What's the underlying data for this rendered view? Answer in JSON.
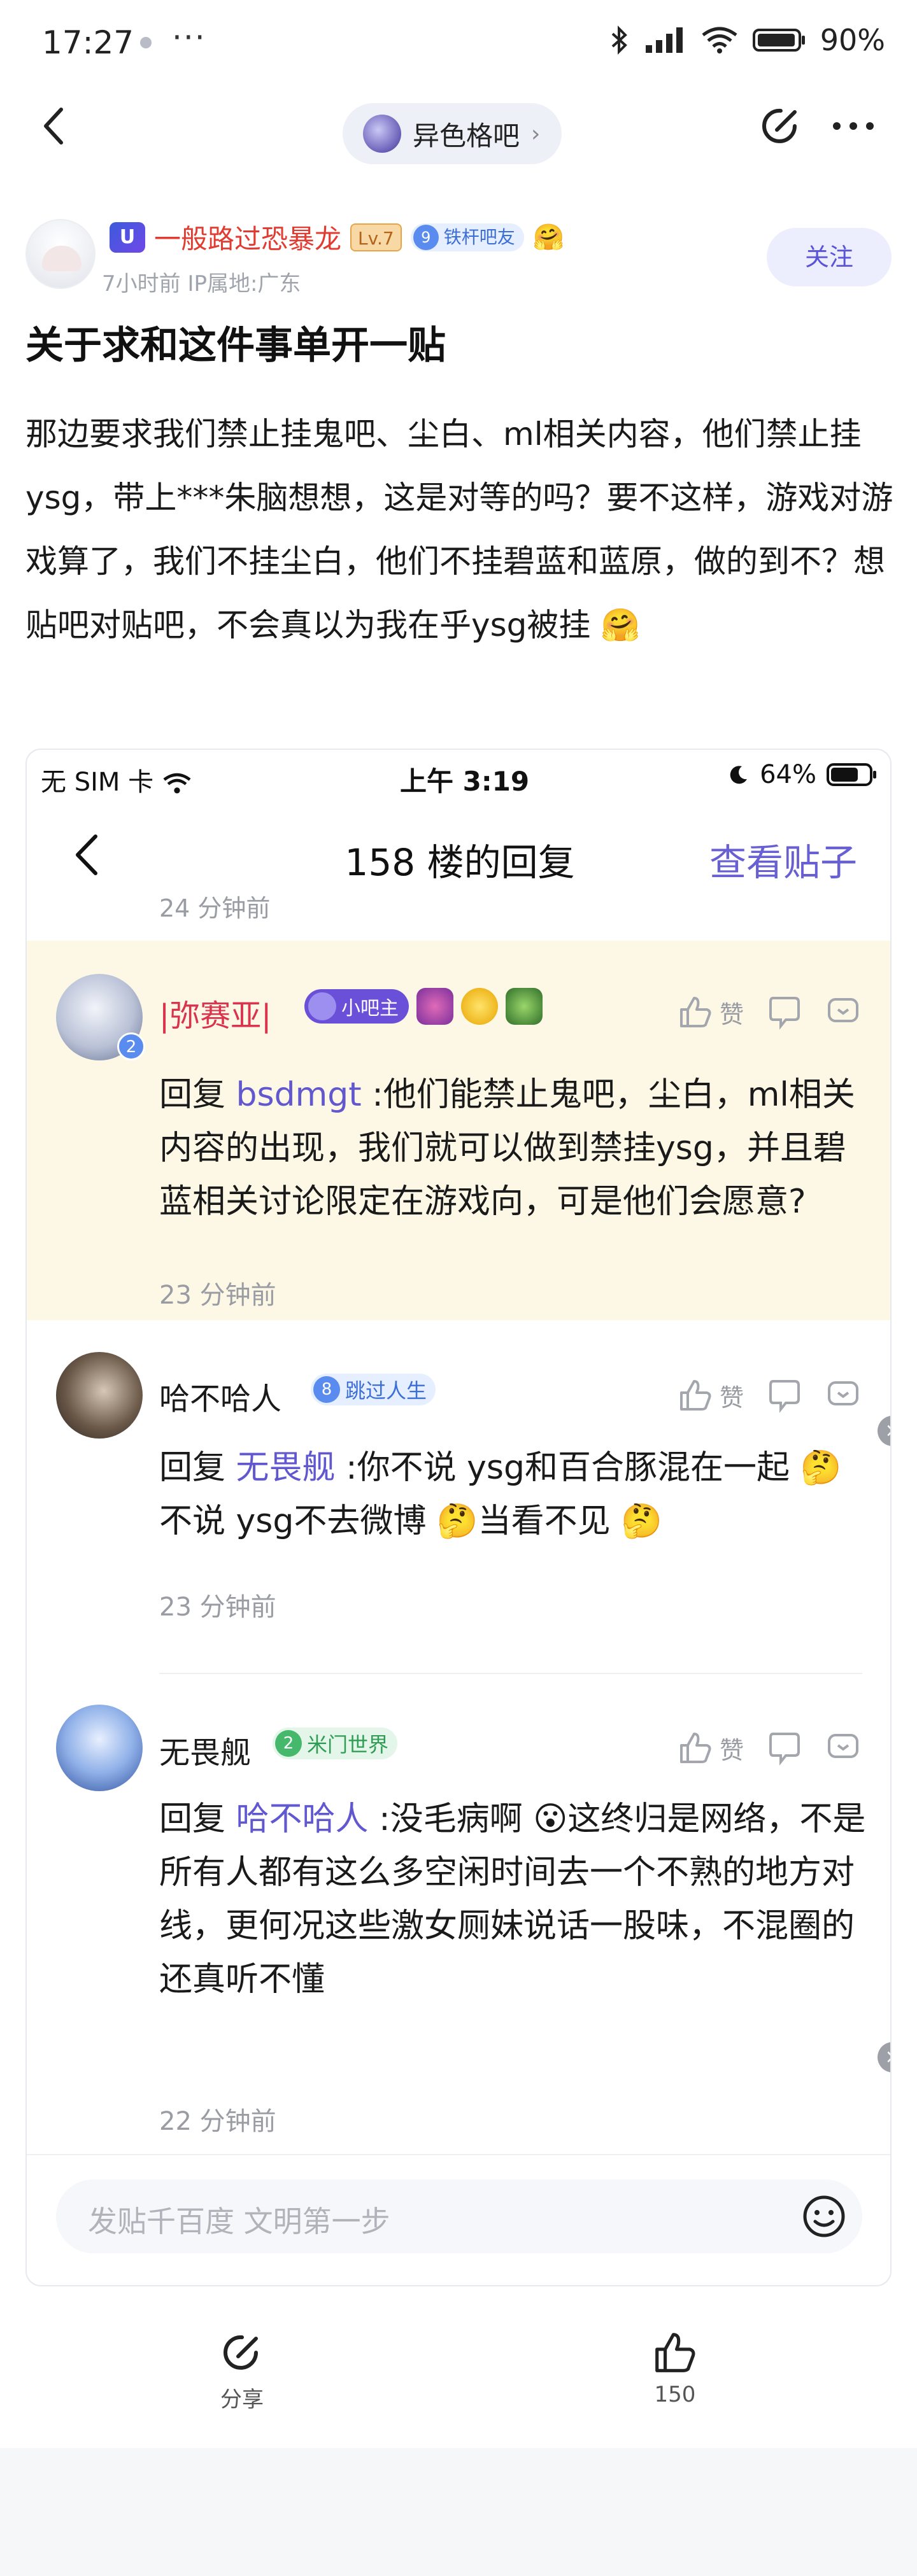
{
  "status_bar": {
    "time": "17:27",
    "more": "···",
    "battery": "90%"
  },
  "nav": {
    "forum_name": "异色格吧",
    "forum_chevron": "›"
  },
  "author": {
    "uv_badge": "U",
    "name": "一般路过恐暴龙",
    "level": "Lv.7",
    "fan_level": "9",
    "fan_title": "铁杆吧友",
    "emoji": "🤗",
    "meta": "7小时前    IP属地:广东",
    "follow_label": "关注"
  },
  "post": {
    "title": "关于求和这件事单开一贴",
    "body": "那边要求我们禁止挂鬼吧、尘白、ml相关内容，他们禁止挂ysg，带上***朱脑想想，这是对等的吗？要不这样，游戏对游戏算了，我们不挂尘白，他们不挂碧蓝和蓝原，做的到不？想贴吧对贴吧，不会真以为我在乎ysg被挂 🤗"
  },
  "screenshot": {
    "status": {
      "carrier": "无 SIM 卡",
      "time": "上午 3:19",
      "battery": "64%"
    },
    "title": "158 楼的回复",
    "view_post": "查看贴子",
    "first_time": "24 分钟前",
    "like_label": "赞",
    "replies": [
      {
        "name": "|弥赛亚|",
        "avatar_level": "2",
        "tag": "小吧主",
        "reply_prefix": "回复 ",
        "reply_to": "bsdmgt",
        "text": " :他们能禁止鬼吧，尘白，ml相关内容的出现，我们就可以做到禁挂ysg，并且碧蓝相关讨论限定在游戏向，可是他们会愿意?",
        "time": "23 分钟前"
      },
      {
        "name": "哈不哈人",
        "level": "8",
        "tag": "跳过人生",
        "reply_prefix": "回复 ",
        "reply_to": "无畏舰",
        "text": " :你不说 ysg和百合豚混在一起 🤔不说 ysg不去微博 🤔当看不见 🤔",
        "time": "23 分钟前"
      },
      {
        "name": "无畏舰",
        "level": "2",
        "tag": "米门世界",
        "reply_prefix": "回复 ",
        "reply_to": "哈不哈人",
        "text": " :没毛病啊 😮这终归是网络，不是所有人都有这么多空闲时间去一个不熟的地方对线，更何况这些激女厕妹说话一股味，不混圈的还真听不懂",
        "time": "22 分钟前"
      }
    ],
    "input_placeholder": "发贴千百度 文明第一步"
  },
  "bottom": {
    "share_label": "分享",
    "like_count": "150"
  }
}
